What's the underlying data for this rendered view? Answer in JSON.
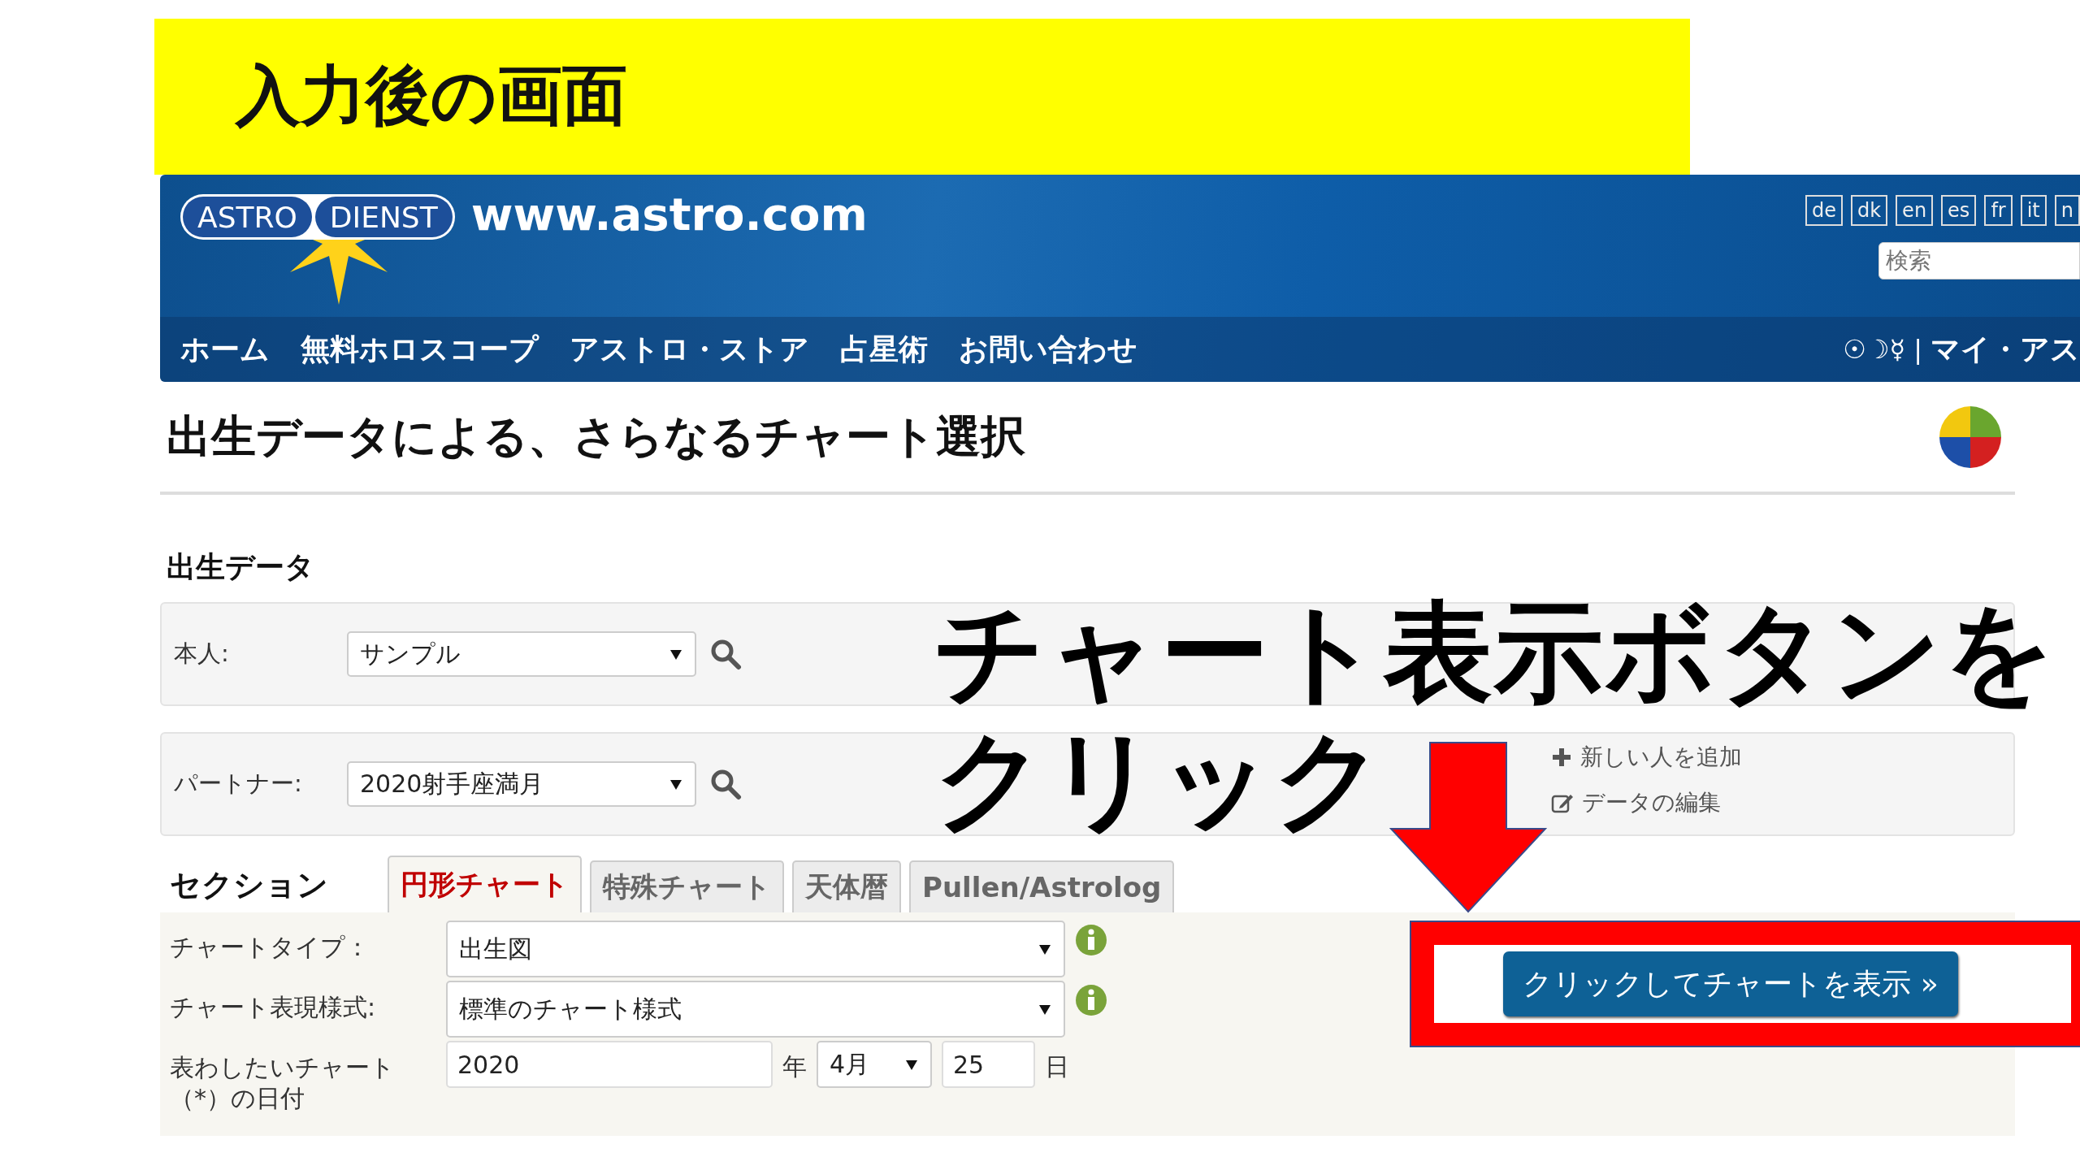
{
  "banner": {
    "title": "入力後の画面"
  },
  "header": {
    "logo": [
      "ASTRO",
      "DIENST"
    ],
    "site": "www.astro.com",
    "languages": [
      "de",
      "dk",
      "en",
      "es",
      "fr",
      "it",
      "n"
    ],
    "search": {
      "placeholder": "検索"
    },
    "nav": [
      "ホーム",
      "無料ホロスコープ",
      "アストロ・ストア",
      "占星術",
      "お問い合わせ"
    ],
    "user_nav": {
      "symbols": "☉☽☿",
      "separator": "|",
      "link": "マイ・アス"
    }
  },
  "page": {
    "title": "出生データによる、さらなるチャート選択"
  },
  "birth_data": {
    "heading": "出生データ",
    "rows": [
      {
        "label": "本人:",
        "value": "サンプル"
      },
      {
        "label": "パートナー:",
        "value": "2020射手座満月",
        "actions": [
          "新しい人を追加",
          "データの編集"
        ]
      }
    ]
  },
  "section": {
    "label": "セクション",
    "tabs": [
      {
        "label": "円形チャート",
        "selected": true
      },
      {
        "label": "特殊チャート",
        "selected": false
      },
      {
        "label": "天体暦",
        "selected": false
      },
      {
        "label": "Pullen/Astrolog",
        "selected": false
      }
    ]
  },
  "form": [
    {
      "kind": "select",
      "label": "チャートタイプ：",
      "value": "出生図"
    },
    {
      "kind": "select",
      "label": "チャート表現様式:",
      "value": "標準のチャート様式"
    },
    {
      "kind": "date",
      "label": "表わしたいチャート（*）の日付",
      "year": "2020",
      "year_unit": "年",
      "month": "4月",
      "day": "25",
      "day_unit": "日"
    }
  ],
  "submit": "クリックしてチャートを表示 »",
  "annotation": {
    "lines": [
      "チャート表示ボタンを",
      "クリック"
    ]
  }
}
